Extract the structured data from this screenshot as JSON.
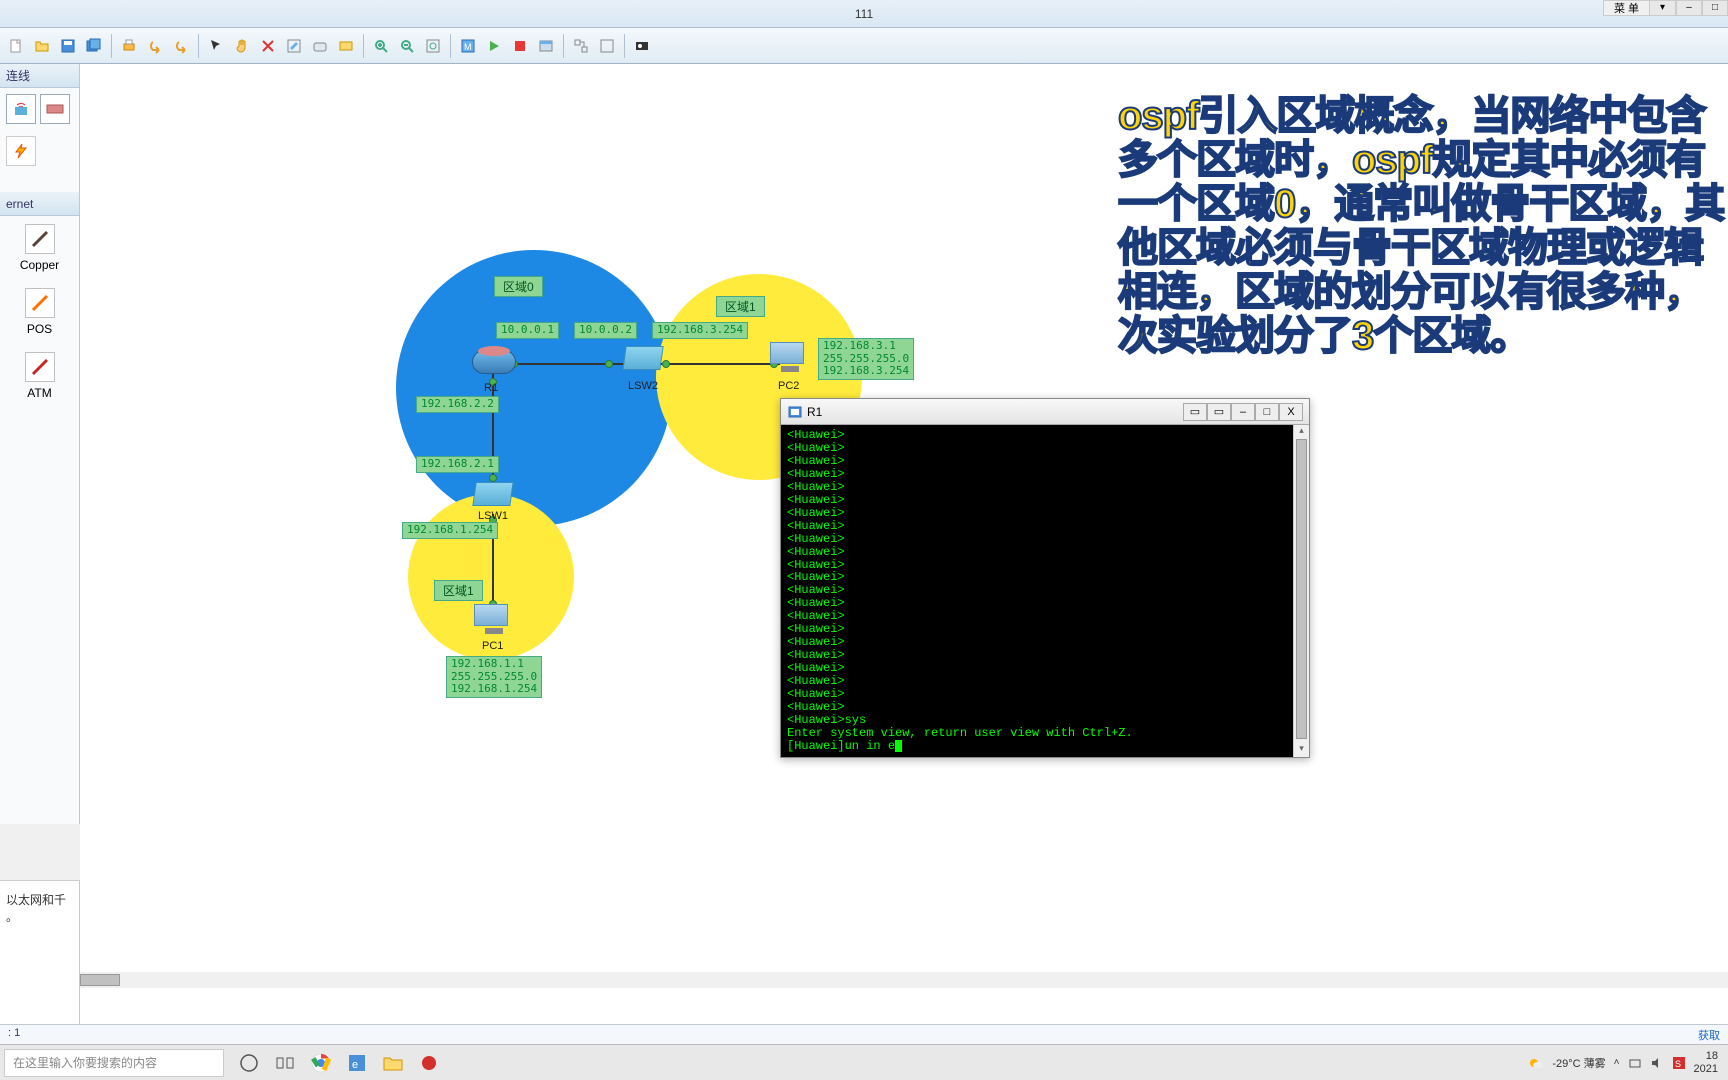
{
  "window": {
    "title": "111",
    "menu_button": "菜 单",
    "ctrl_min": "–",
    "ctrl_max": "□"
  },
  "toolbar_icons": [
    "new",
    "open",
    "save",
    "saveall",
    "print",
    "undo",
    "redo",
    "pointer",
    "hand",
    "delete",
    "edit",
    "note",
    "rect",
    "zoomin",
    "zoomout",
    "fit",
    "snap",
    "play",
    "stop",
    "window",
    "group",
    "panel",
    "export"
  ],
  "sidebar": {
    "section1_title": "连线",
    "section2_title": "ernet",
    "items": [
      {
        "label": "Copper",
        "icon": "line-brown"
      },
      {
        "label": "POS",
        "icon": "line-orange"
      },
      {
        "label": "ATM",
        "icon": "line-red"
      }
    ],
    "bottom_desc": "以太网和千\n。"
  },
  "areas": {
    "a0": "区域0",
    "a1": "区域1",
    "a1b": "区域1"
  },
  "devices": {
    "r1": "R1",
    "lsw1": "LSW1",
    "lsw2": "LSW2",
    "pc1": "PC1",
    "pc2": "PC2"
  },
  "ips": {
    "r1_e0": "10.0.0.1",
    "lsw2_w": "10.0.0.2",
    "lsw2_e": "192.168.3.254",
    "pc2": "192.168.3.1\n255.255.255.0\n192.168.3.254",
    "r1_s": "192.168.2.2",
    "lsw1_n": "192.168.2.1",
    "lsw1_s": "192.168.1.254",
    "pc1": "192.168.1.1\n255.255.255.0\n192.168.1.254"
  },
  "overlay_text": "ospf引入区域概念，当网络中包含多个区域时，ospf规定其中必须有一个区域0，通常叫做骨干区域，其他区域必须与骨干区域物理或逻辑相连，区域的划分可以有很多种，次实验划分了3个区域。",
  "terminal": {
    "title": "R1",
    "lines": [
      "<Huawei>",
      "<Huawei>",
      "<Huawei>",
      "<Huawei>",
      "<Huawei>",
      "<Huawei>",
      "<Huawei>",
      "<Huawei>",
      "<Huawei>",
      "<Huawei>",
      "<Huawei>",
      "<Huawei>",
      "<Huawei>",
      "<Huawei>",
      "<Huawei>",
      "<Huawei>",
      "<Huawei>",
      "<Huawei>",
      "<Huawei>",
      "<Huawei>",
      "<Huawei>",
      "<Huawei>",
      "<Huawei>sys",
      "Enter system view, return user view with Ctrl+Z.",
      "[Huawei]un in e"
    ],
    "ctrls": {
      "tab1": "▭",
      "tab2": "▭",
      "min": "–",
      "max": "□",
      "close": "X"
    }
  },
  "statusbar": {
    "left": ": 1",
    "right": "获取"
  },
  "taskbar": {
    "search_placeholder": "在这里输入你要搜索的内容",
    "tray": {
      "weather": "-29°C 薄雾",
      "time": "18",
      "date": "2021"
    }
  }
}
